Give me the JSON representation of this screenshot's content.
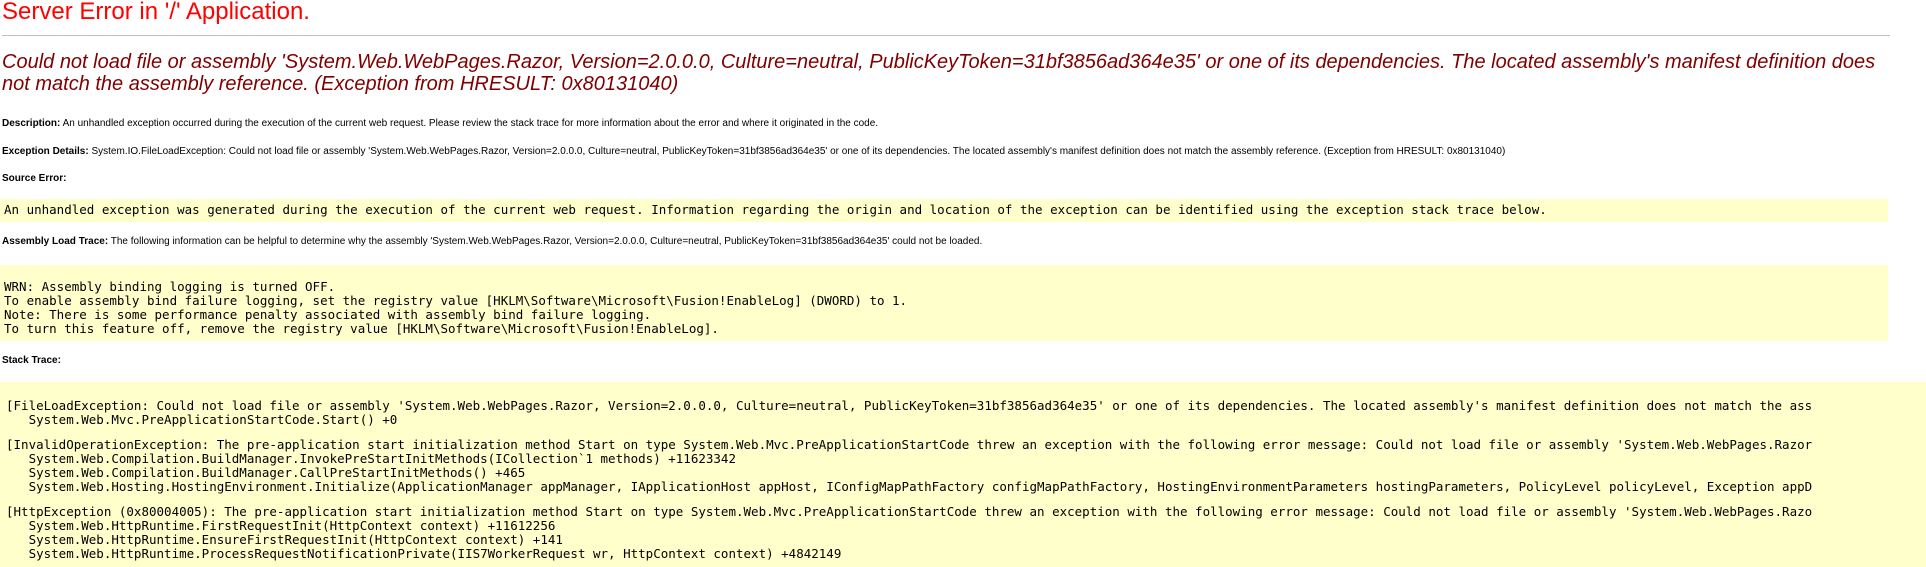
{
  "page": {
    "title": "Server Error in '/' Application.",
    "error_message": "Could not load file or assembly 'System.Web.WebPages.Razor, Version=2.0.0.0, Culture=neutral, PublicKeyToken=31bf3856ad364e35' or one of its dependencies. The located assembly's manifest definition does not match the assembly reference. (Exception from HRESULT: 0x80131040)"
  },
  "description": {
    "label": "Description:",
    "text": "An unhandled exception occurred during the execution of the current web request. Please review the stack trace for more information about the error and where it originated in the code."
  },
  "exception_details": {
    "label": "Exception Details:",
    "text": "System.IO.FileLoadException: Could not load file or assembly 'System.Web.WebPages.Razor, Version=2.0.0.0, Culture=neutral, PublicKeyToken=31bf3856ad364e35' or one of its dependencies. The located assembly's manifest definition does not match the assembly reference. (Exception from HRESULT: 0x80131040)"
  },
  "source_error": {
    "label": "Source Error:",
    "text": "An unhandled exception was generated during the execution of the current web request. Information regarding the origin and location of the exception can be identified using the exception stack trace below."
  },
  "assembly_load_trace": {
    "label": "Assembly Load Trace:",
    "text": "The following information can be helpful to determine why the assembly 'System.Web.WebPages.Razor, Version=2.0.0.0, Culture=neutral, PublicKeyToken=31bf3856ad364e35' could not be loaded.",
    "log": "WRN: Assembly binding logging is turned OFF.\nTo enable assembly bind failure logging, set the registry value [HKLM\\Software\\Microsoft\\Fusion!EnableLog] (DWORD) to 1.\nNote: There is some performance penalty associated with assembly bind failure logging.\nTo turn this feature off, remove the registry value [HKLM\\Software\\Microsoft\\Fusion!EnableLog]."
  },
  "stack_trace": {
    "label": "Stack Trace:",
    "frames": [
      "[FileLoadException: Could not load file or assembly 'System.Web.WebPages.Razor, Version=2.0.0.0, Culture=neutral, PublicKeyToken=31bf3856ad364e35' or one of its dependencies. The located assembly's manifest definition does not match the ass\n   System.Web.Mvc.PreApplicationStartCode.Start() +0",
      "[InvalidOperationException: The pre-application start initialization method Start on type System.Web.Mvc.PreApplicationStartCode threw an exception with the following error message: Could not load file or assembly 'System.Web.WebPages.Razor\n   System.Web.Compilation.BuildManager.InvokePreStartInitMethods(ICollection`1 methods) +11623342\n   System.Web.Compilation.BuildManager.CallPreStartInitMethods() +465\n   System.Web.Hosting.HostingEnvironment.Initialize(ApplicationManager appManager, IApplicationHost appHost, IConfigMapPathFactory configMapPathFactory, HostingEnvironmentParameters hostingParameters, PolicyLevel policyLevel, Exception appD",
      "[HttpException (0x80004005): The pre-application start initialization method Start on type System.Web.Mvc.PreApplicationStartCode threw an exception with the following error message: Could not load file or assembly 'System.Web.WebPages.Razo\n   System.Web.HttpRuntime.FirstRequestInit(HttpContext context) +11612256\n   System.Web.HttpRuntime.EnsureFirstRequestInit(HttpContext context) +141\n   System.Web.HttpRuntime.ProcessRequestNotificationPrivate(IIS7WorkerRequest wr, HttpContext context) +4842149"
    ]
  },
  "colors": {
    "title": "#ff0000",
    "error_message": "#800000",
    "code_background": "#ffffcc",
    "rule": "#c0c0c0"
  }
}
